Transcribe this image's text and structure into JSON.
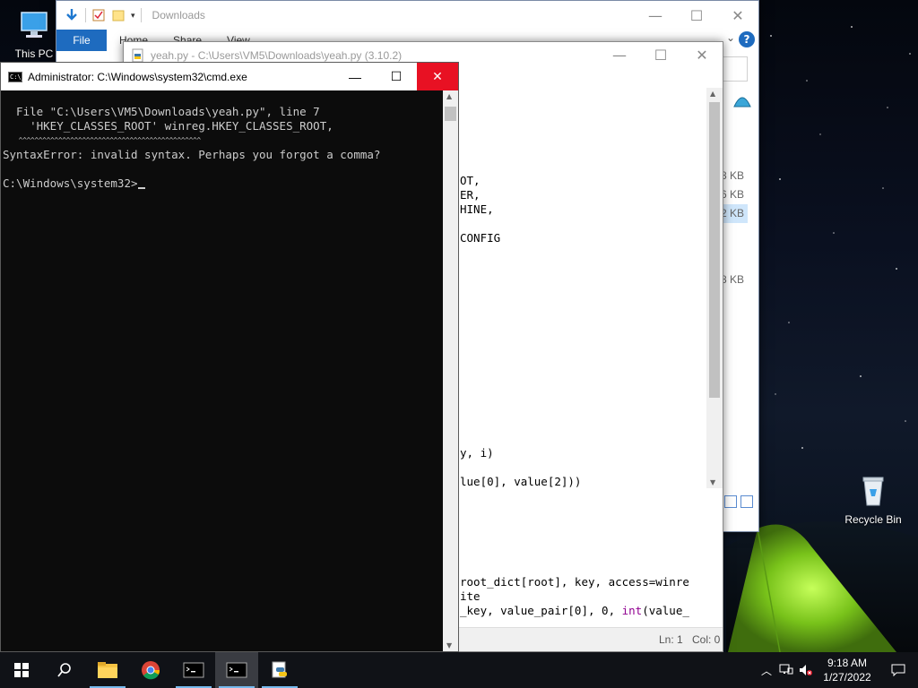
{
  "desktop": {
    "icons": [
      {
        "label": "This PC",
        "icon": "computer-icon"
      },
      {
        "label": "Recycle Bin",
        "icon": "recycle-bin-icon"
      }
    ]
  },
  "explorer": {
    "title": "Downloads",
    "ribbon_tabs": [
      "File",
      "Home",
      "Share",
      "View"
    ],
    "file_sizes": [
      "8 KB",
      "6 KB",
      "2 KB",
      "8 KB"
    ],
    "controls": {
      "minimize": "—",
      "maximize": "☐",
      "close": "✕"
    },
    "help": "?"
  },
  "idle": {
    "title": "yeah.py - C:\\Users\\VM5\\Downloads\\yeah.py (3.10.2)",
    "code_lines": [
      {
        "text": "OT,"
      },
      {
        "text": "ER,"
      },
      {
        "text": "HINE,"
      },
      {
        "text": "CONFIG"
      },
      {
        "text": "y, i)"
      },
      {
        "text": "lue[0], value[2]))"
      },
      {
        "text": "root_dict[root], key, access=winre"
      },
      {
        "text": "ite"
      },
      {
        "text": "_key, value_pair[0], 0, ",
        "kw": "int",
        "tail": "(value_"
      }
    ],
    "status": {
      "ln": "Ln: 1",
      "col": "Col: 0"
    }
  },
  "cmd": {
    "title": "Administrator: C:\\Windows\\system32\\cmd.exe",
    "icon_text": "C:\\_",
    "lines": [
      "  File \"C:\\Users\\VM5\\Downloads\\yeah.py\", line 7",
      "    'HKEY_CLASSES_ROOT' winreg.HKEY_CLASSES_ROOT,",
      "    ^^^^^^^^^^^^^^^^^^^^^^^^^^^^^^^^^^^^^^^^^^^^^^",
      "SyntaxError: invalid syntax. Perhaps you forgot a comma?",
      "",
      "C:\\Windows\\system32>"
    ],
    "controls": {
      "minimize": "—",
      "maximize": "☐",
      "close": "✕"
    }
  },
  "taskbar": {
    "apps": [
      "start-icon",
      "search-icon",
      "file-explorer-icon",
      "chrome-icon",
      "cmd-icon",
      "cmd-icon",
      "python-idle-icon"
    ],
    "clock": {
      "time": "9:18 AM",
      "date": "1/27/2022"
    }
  },
  "colors": {
    "accent": "#1e6bbf",
    "close_red": "#e81123",
    "console_bg": "#0c0c0c",
    "console_fg": "#cccccc",
    "taskbar": "#101217",
    "tent_green": "#7ac41f"
  }
}
